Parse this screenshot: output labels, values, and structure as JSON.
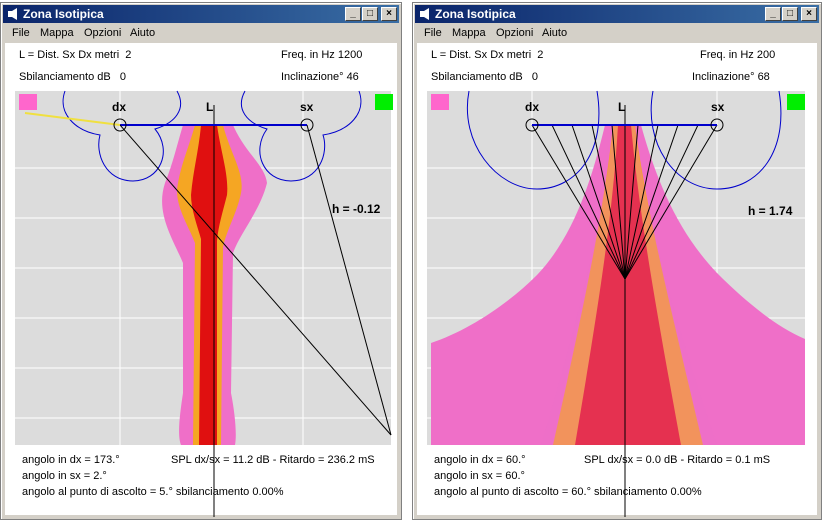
{
  "windows": [
    {
      "title": "Zona Isotipica",
      "menu": [
        "File",
        "Mappa",
        "Opzioni",
        "Aiuto"
      ],
      "params": {
        "dist_label": "L = Dist. Sx Dx metri",
        "dist_value": "2",
        "freq_label": "Freq. in Hz",
        "freq_value": "1200",
        "sbil_label": "Sbilanciamento dB",
        "sbil_value": "0",
        "incl_label": "Inclinazione°",
        "incl_value": "46"
      },
      "labels": {
        "dx": "dx",
        "sx": "sx",
        "L": "L",
        "h": "h = -0.12"
      },
      "footer": {
        "angolo_dx": "angolo in dx = 173.°",
        "angolo_sx": "angolo in sx = 2.°",
        "angolo_ascolto": "angolo al punto di ascolto = 5.° sbilanciamento 0.00%",
        "spl": "SPL dx/sx = 11.2 dB  - Ritardo = 236.2 mS"
      },
      "colors": {
        "zone_outer": "#ef6fc8",
        "zone_mid": "#f5a623",
        "zone_inner": "#e01010",
        "marker_left": "#ff66cc",
        "marker_right": "#00ee00",
        "baseline": "#0000cc"
      }
    },
    {
      "title": "Zona Isotipica",
      "menu": [
        "File",
        "Mappa",
        "Opzioni",
        "Aiuto"
      ],
      "params": {
        "dist_label": "L = Dist. Sx Dx metri",
        "dist_value": "2",
        "freq_label": "Freq. in Hz",
        "freq_value": "200",
        "sbil_label": "Sbilanciamento dB",
        "sbil_value": "0",
        "incl_label": "Inclinazione°",
        "incl_value": "68"
      },
      "labels": {
        "dx": "dx",
        "sx": "sx",
        "L": "L",
        "h": "h = 1.74"
      },
      "footer": {
        "angolo_dx": "angolo in dx = 60.°",
        "angolo_sx": "angolo in sx = 60.°",
        "angolo_ascolto": "angolo al punto di ascolto = 60.° sbilanciamento 0.00%",
        "spl": "SPL dx/sx = 0.0 dB  - Ritardo = 0.1 mS"
      },
      "colors": {
        "zone_outer": "#ef6fc8",
        "zone_mid": "#f5a623",
        "zone_inner": "#e01010",
        "marker_left": "#ff66cc",
        "marker_right": "#00ee00",
        "baseline": "#0000cc"
      }
    }
  ]
}
